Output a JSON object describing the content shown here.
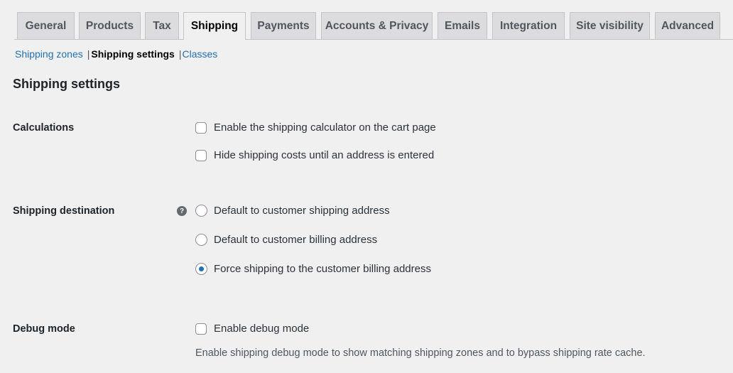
{
  "tabs": [
    {
      "label": "General",
      "active": false
    },
    {
      "label": "Products",
      "active": false
    },
    {
      "label": "Tax",
      "active": false
    },
    {
      "label": "Shipping",
      "active": true
    },
    {
      "label": "Payments",
      "active": false
    },
    {
      "label": "Accounts & Privacy",
      "active": false
    },
    {
      "label": "Emails",
      "active": false
    },
    {
      "label": "Integration",
      "active": false
    },
    {
      "label": "Site visibility",
      "active": false
    },
    {
      "label": "Advanced",
      "active": false
    }
  ],
  "subnav": {
    "zones": "Shipping zones",
    "settings": "Shipping settings",
    "classes": "Classes",
    "separator": "|"
  },
  "heading": "Shipping settings",
  "calculations": {
    "label": "Calculations",
    "options": [
      {
        "label": "Enable the shipping calculator on the cart page",
        "checked": false
      },
      {
        "label": "Hide shipping costs until an address is entered",
        "checked": false
      }
    ]
  },
  "destination": {
    "label": "Shipping destination",
    "help_icon": "question-mark-icon",
    "help_glyph": "?",
    "options": [
      {
        "label": "Default to customer shipping address",
        "checked": false
      },
      {
        "label": "Default to customer billing address",
        "checked": false
      },
      {
        "label": "Force shipping to the customer billing address",
        "checked": true
      }
    ]
  },
  "debug": {
    "label": "Debug mode",
    "option": {
      "label": "Enable debug mode",
      "checked": false
    },
    "description": "Enable shipping debug mode to show matching shipping zones and to bypass shipping rate cache."
  },
  "colors": {
    "accent": "#2271b1",
    "background": "#f0f0f1",
    "tab_inactive": "#dcdcde"
  }
}
